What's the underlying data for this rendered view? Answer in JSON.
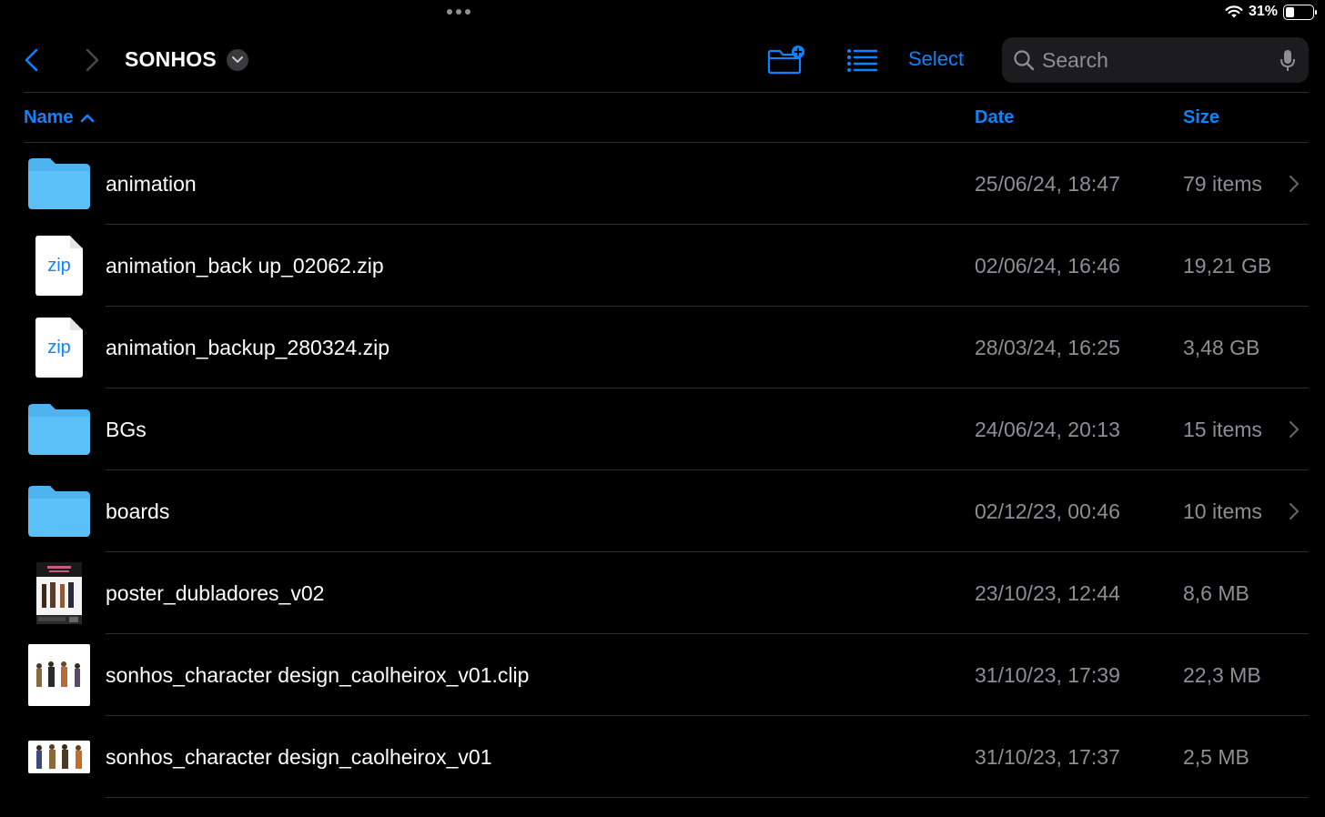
{
  "status": {
    "wifi_icon": "wifi-icon",
    "battery_percent": "31%",
    "battery_level": 0.31
  },
  "toolbar": {
    "folder_title": "SONHOS",
    "select_label": "Select",
    "search_placeholder": "Search",
    "accent_color": "#0a84ff"
  },
  "columns": {
    "name": "Name",
    "date": "Date",
    "size": "Size",
    "sort": "ascending"
  },
  "files": [
    {
      "name": "animation",
      "date": "25/06/24, 18:47",
      "size": "79 items",
      "kind": "folder"
    },
    {
      "name": "animation_back up_02062.zip",
      "date": "02/06/24, 16:46",
      "size": "19,21 GB",
      "kind": "zip",
      "badge": "zip"
    },
    {
      "name": "animation_backup_280324.zip",
      "date": "28/03/24, 16:25",
      "size": "3,48 GB",
      "kind": "zip",
      "badge": "zip"
    },
    {
      "name": "BGs",
      "date": "24/06/24, 20:13",
      "size": "15 items",
      "kind": "folder"
    },
    {
      "name": "boards",
      "date": "02/12/23, 00:46",
      "size": "10 items",
      "kind": "folder"
    },
    {
      "name": "poster_dubladores_v02",
      "date": "23/10/23, 12:44",
      "size": "8,6 MB",
      "kind": "image-poster"
    },
    {
      "name": "sonhos_character design_caolheirox_v01.clip",
      "date": "31/10/23, 17:39",
      "size": "22,3 MB",
      "kind": "image-clip"
    },
    {
      "name": "sonhos_character design_caolheirox_v01",
      "date": "31/10/23, 17:37",
      "size": "2,5 MB",
      "kind": "image-wide"
    }
  ]
}
